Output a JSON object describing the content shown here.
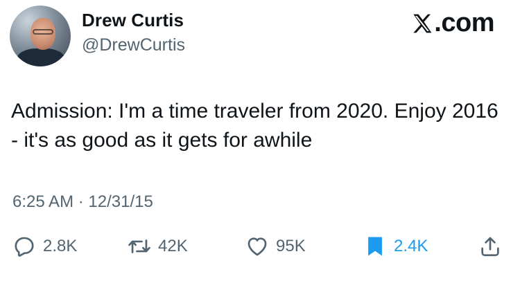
{
  "author": {
    "name": "Drew Curtis",
    "handle": "@DrewCurtis"
  },
  "brand": {
    "label": ".com",
    "icon": "x-logo-icon"
  },
  "tweet": {
    "text": "Admission: I'm a time traveler from 2020. Enjoy 2016 - it's as good as it gets for awhile",
    "timestamp": "6:25 AM · 12/31/15"
  },
  "actions": {
    "replies": "2.8K",
    "reposts": "42K",
    "likes": "95K",
    "bookmarks": "2.4K",
    "bookmark_active": true,
    "share_icon": "share-icon"
  },
  "colors": {
    "text": "#0f1419",
    "secondary": "#536471",
    "accent": "#1d9bf0"
  }
}
